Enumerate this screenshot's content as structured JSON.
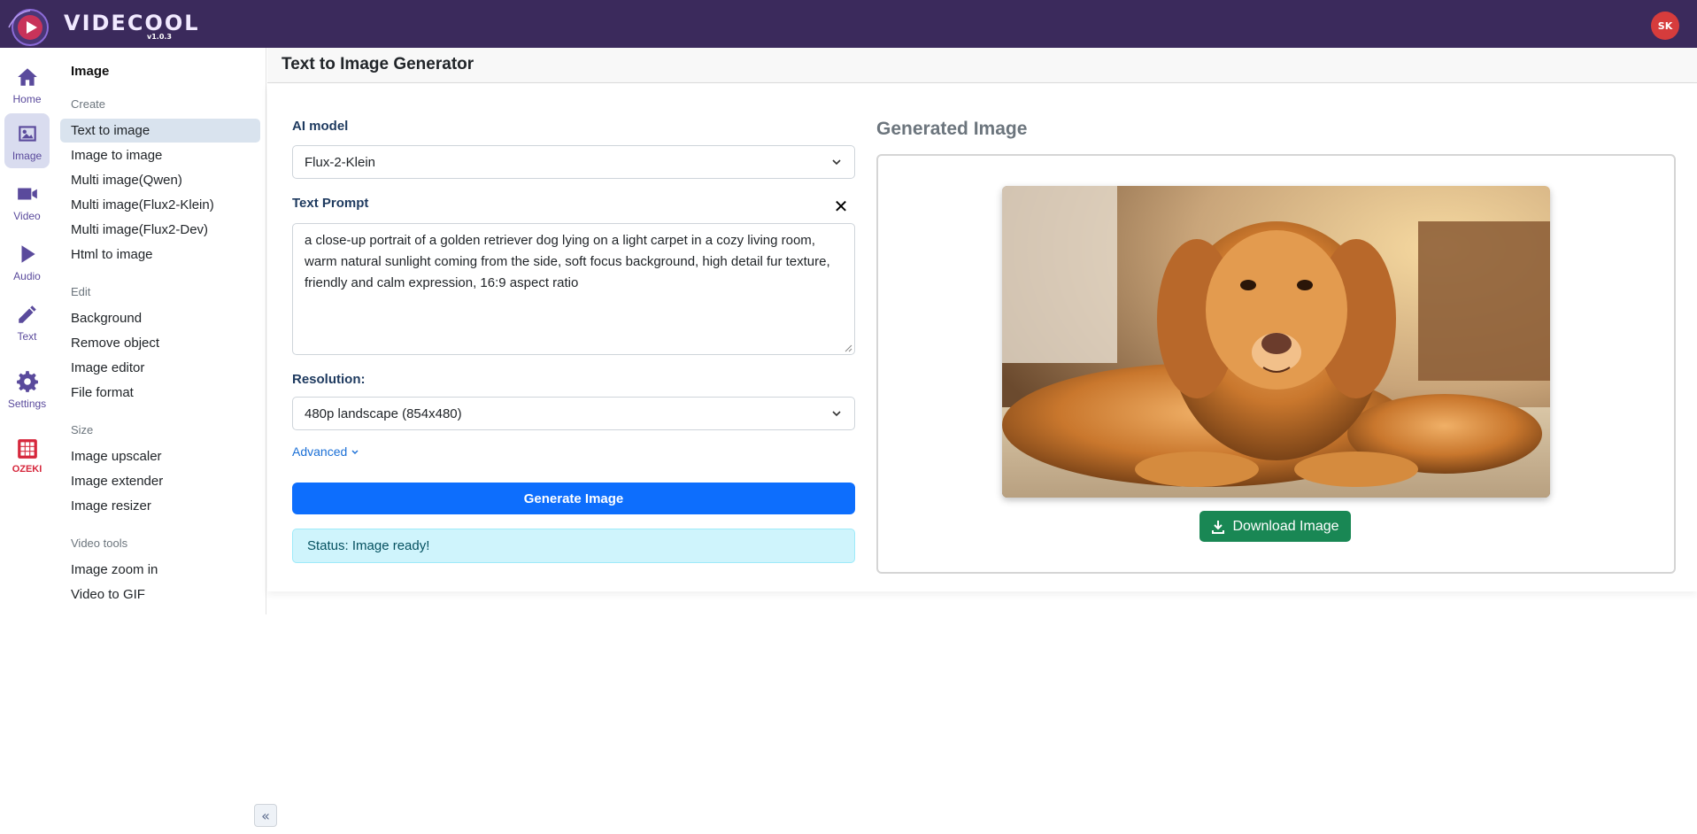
{
  "app": {
    "brand": "VIDECOOL",
    "version": "v1.0.3",
    "avatar": "SK"
  },
  "rail": [
    {
      "label": "Home",
      "icon": "home-icon"
    },
    {
      "label": "Image",
      "icon": "image-icon"
    },
    {
      "label": "Video",
      "icon": "video-icon"
    },
    {
      "label": "Audio",
      "icon": "play-icon"
    },
    {
      "label": "Text",
      "icon": "pencil-icon"
    },
    {
      "label": "Settings",
      "icon": "gear-icon"
    },
    {
      "label": "OZEKI",
      "icon": "ozeki-logo-icon"
    }
  ],
  "subnav": {
    "title": "Image",
    "sections": {
      "create": "Create",
      "edit": "Edit",
      "size": "Size",
      "video_tools": "Video tools"
    },
    "items": {
      "text_to_image": "Text to image",
      "image_to_image": "Image to image",
      "multi_qwen": "Multi image(Qwen)",
      "multi_flux2_klein": "Multi image(Flux2-Klein)",
      "multi_flux2_dev": "Multi image(Flux2-Dev)",
      "html_to_image": "Html to image",
      "background": "Background",
      "remove_object": "Remove object",
      "image_editor": "Image editor",
      "file_format": "File format",
      "image_upscaler": "Image upscaler",
      "image_extender": "Image extender",
      "image_resizer": "Image resizer",
      "image_zoom_in": "Image zoom in",
      "video_to_gif": "Video to GIF"
    }
  },
  "page": {
    "title": "Text to Image Generator"
  },
  "form": {
    "model_label": "AI model",
    "model_value": "Flux-2-Klein",
    "prompt_label": "Text Prompt",
    "prompt_clear": "✕",
    "prompt_value": "a close-up portrait of a golden retriever dog lying on a light carpet in a cozy living room, warm natural sunlight coming from the side, soft focus background, high detail fur texture, friendly and calm expression, 16:9 aspect ratio",
    "resolution_label": "Resolution:",
    "resolution_value": "480p landscape (854x480)",
    "advanced_label": "Advanced",
    "generate_label": "Generate Image",
    "status_text": "Status: Image ready!"
  },
  "result": {
    "title": "Generated Image",
    "download_label": "Download Image"
  },
  "colors": {
    "topbar": "#3b2a5c",
    "accent": "#5a4a9c",
    "primary_button": "#0d6efd",
    "download_button": "#198754",
    "status_bg": "#cff4fc",
    "avatar": "#d63c3c"
  }
}
